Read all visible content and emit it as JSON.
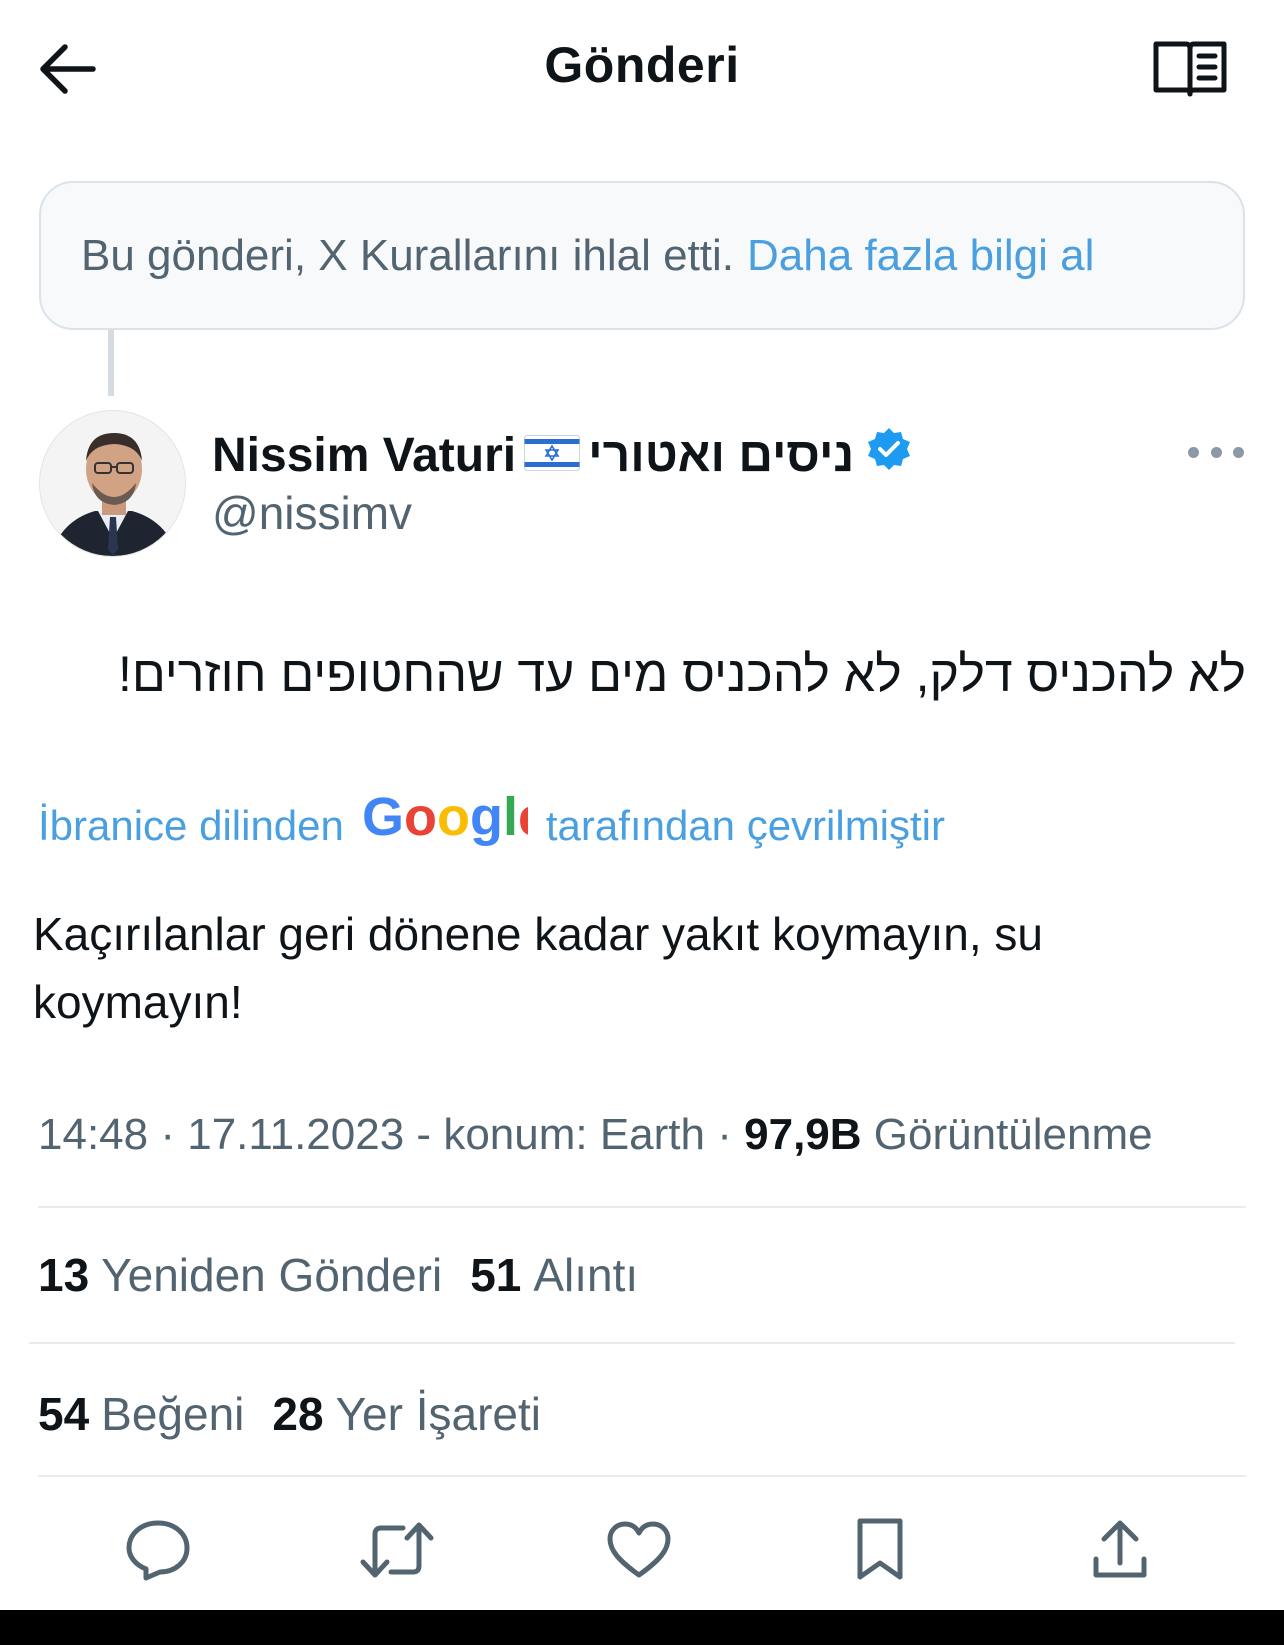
{
  "header": {
    "title": "Gönderi",
    "back_icon": "arrow-left-icon",
    "reader_icon": "book-icon"
  },
  "notice": {
    "text": "Bu gönderi, X Kurallarını ihlal etti.",
    "link": "Daha fazla bilgi al"
  },
  "author": {
    "name": "Nissim Vaturi",
    "flag": "🇮🇱",
    "name_hebrew": "ניסים ואטורי",
    "verified": true,
    "handle": "@nissimv"
  },
  "post": {
    "text_hebrew": "לא להכניס דלק, לא להכניס מים עד שהחטופים חוזרים!",
    "translation_prefix": "İbranice dilinden",
    "translation_brand": "Google",
    "translation_suffix": "tarafından çevrilmiştir",
    "translated_text": "Kaçırılanlar geri dönene kadar yakıt koymayın, su koymayın!",
    "time": "14:48",
    "date": "17.11.2023",
    "location": "konum: Earth",
    "views": "97,9B",
    "views_label": "Görüntülenme"
  },
  "stats": {
    "reposts": "13",
    "reposts_label": "Yeniden Gönderi",
    "quotes": "51",
    "quotes_label": "Alıntı",
    "likes": "54",
    "likes_label": "Beğeni",
    "bookmarks": "28",
    "bookmarks_label": "Yer İşareti"
  },
  "actions": [
    "reply-icon",
    "repost-icon",
    "like-icon",
    "bookmark-icon",
    "share-icon"
  ],
  "colors": {
    "link": "#4a9fe1",
    "secondary_text": "#536471",
    "verified": "#1d9bf0",
    "google_blue": "#4285F4",
    "google_red": "#EA4335",
    "google_yellow": "#FBBC05",
    "google_green": "#34A853"
  }
}
